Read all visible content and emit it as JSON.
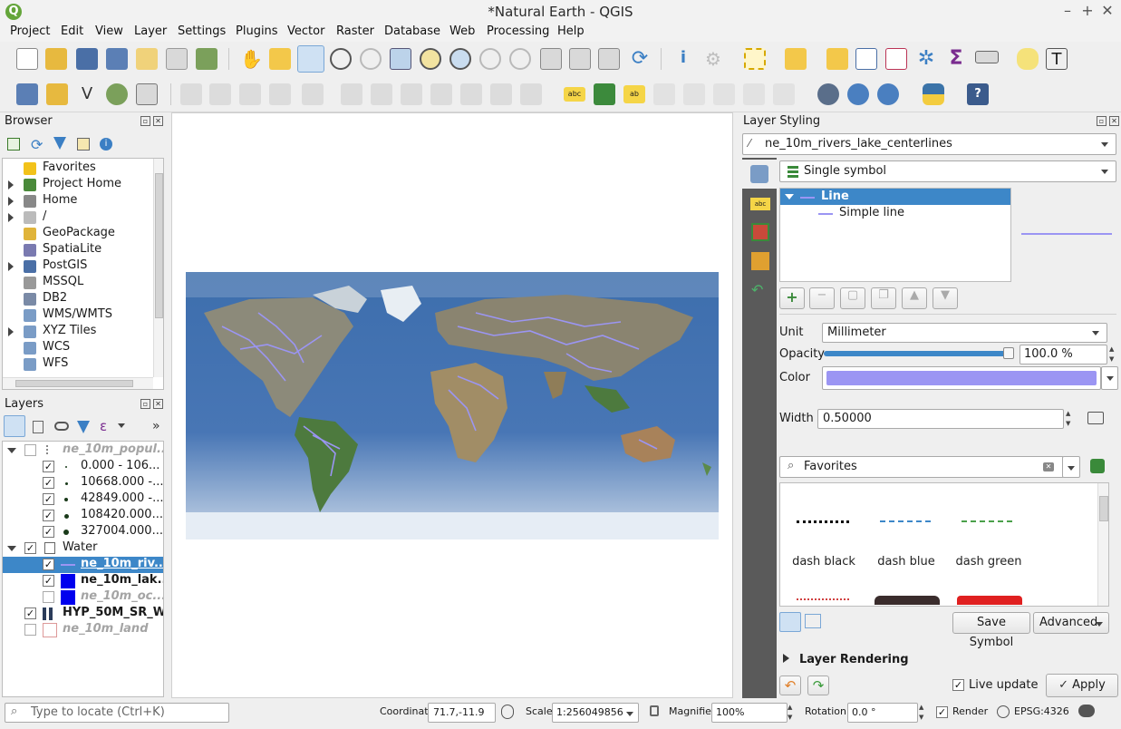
{
  "window": {
    "title": "*Natural Earth - QGIS"
  },
  "menu": [
    "Project",
    "Edit",
    "View",
    "Layer",
    "Settings",
    "Plugins",
    "Vector",
    "Raster",
    "Database",
    "Web",
    "Processing",
    "Help"
  ],
  "browser": {
    "title": "Browser",
    "items": [
      {
        "label": "Favorites",
        "expandable": false,
        "icon": "star-icon"
      },
      {
        "label": "Project Home",
        "expandable": true,
        "icon": "project-home-icon"
      },
      {
        "label": "Home",
        "expandable": true,
        "icon": "home-icon"
      },
      {
        "label": "/",
        "expandable": true,
        "icon": "folder-icon"
      },
      {
        "label": "GeoPackage",
        "expandable": false,
        "icon": "geopackage-icon"
      },
      {
        "label": "SpatiaLite",
        "expandable": false,
        "icon": "spatialite-icon"
      },
      {
        "label": "PostGIS",
        "expandable": true,
        "icon": "postgis-icon"
      },
      {
        "label": "MSSQL",
        "expandable": false,
        "icon": "mssql-icon"
      },
      {
        "label": "DB2",
        "expandable": false,
        "icon": "db2-icon"
      },
      {
        "label": "WMS/WMTS",
        "expandable": false,
        "icon": "wms-icon"
      },
      {
        "label": "XYZ Tiles",
        "expandable": true,
        "icon": "xyz-icon"
      },
      {
        "label": "WCS",
        "expandable": false,
        "icon": "wcs-icon"
      },
      {
        "label": "WFS",
        "expandable": false,
        "icon": "wfs-icon"
      }
    ]
  },
  "layers": {
    "title": "Layers",
    "items": [
      {
        "label": "ne_10m_popul...",
        "checked": false,
        "style": "gray"
      },
      {
        "label": "0.000 - 106...",
        "checked": true,
        "style": "normal"
      },
      {
        "label": "10668.000 -...",
        "checked": true,
        "style": "normal"
      },
      {
        "label": "42849.000 -...",
        "checked": true,
        "style": "normal"
      },
      {
        "label": "108420.000...",
        "checked": true,
        "style": "normal"
      },
      {
        "label": "327004.000...",
        "checked": true,
        "style": "normal"
      },
      {
        "label": "Water",
        "checked": true,
        "style": "normal"
      },
      {
        "label": "ne_10m_riv...",
        "checked": true,
        "style": "selected"
      },
      {
        "label": "ne_10m_lak...",
        "checked": true,
        "style": "bold"
      },
      {
        "label": "ne_10m_oc...",
        "checked": false,
        "style": "gray"
      },
      {
        "label": "HYP_50M_SR_W",
        "checked": true,
        "style": "bold"
      },
      {
        "label": "ne_10m_land",
        "checked": false,
        "style": "gray"
      }
    ]
  },
  "styling": {
    "title": "Layer Styling",
    "layer": "ne_10m_rivers_lake_centerlines",
    "renderer": "Single symbol",
    "symbol_tree": {
      "root": "Line",
      "child": "Simple line"
    },
    "unit_label": "Unit",
    "unit_value": "Millimeter",
    "opacity_label": "Opacity",
    "opacity_value": "100.0 %",
    "opacity_fraction": 1.0,
    "color_label": "Color",
    "color_value": "#9b95f3",
    "width_label": "Width",
    "width_value": "0.50000",
    "search_value": "Favorites",
    "symbols": [
      "dash  black",
      "dash blue",
      "dash green"
    ],
    "save_symbol": "Save Symbol",
    "advanced": "Advanced",
    "layer_rendering": "Layer Rendering",
    "live_update": "Live update",
    "apply": "Apply"
  },
  "status": {
    "locate_placeholder": "Type to locate (Ctrl+K)",
    "coordinate_label": "Coordinate",
    "coordinate_value": "71.7,-11.9",
    "scale_label": "Scale",
    "scale_value": "1:256049856",
    "magnifier_label": "Magnifier",
    "magnifier_value": "100%",
    "rotation_label": "Rotation",
    "rotation_value": "0.0 °",
    "render_label": "Render",
    "crs": "EPSG:4326"
  },
  "colors": {
    "accent": "#3d87c8",
    "river": "#9b95f3",
    "ocean": "#4472b0"
  }
}
